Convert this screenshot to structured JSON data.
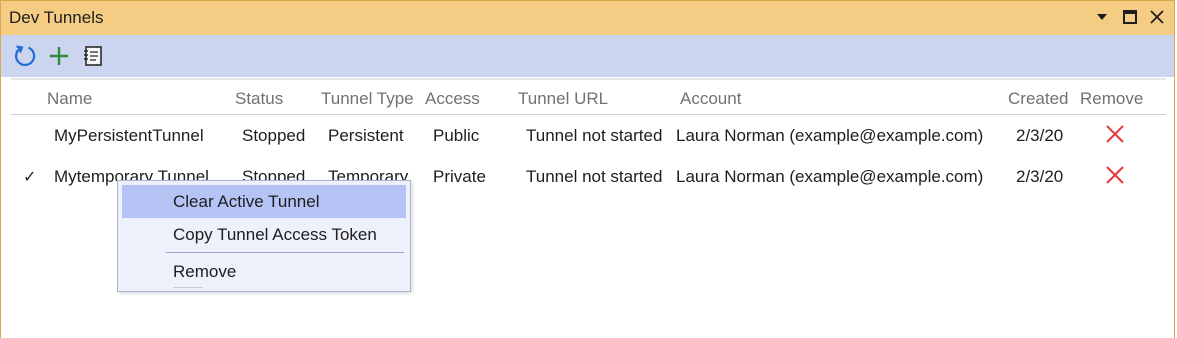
{
  "window": {
    "title": "Dev Tunnels",
    "buttons": {
      "dropdown": "chevron-down-icon",
      "maximize": "maximize-icon",
      "close": "close-icon"
    }
  },
  "toolbar": {
    "icons": [
      "refresh-icon",
      "add-icon",
      "notebook-icon"
    ]
  },
  "columns": [
    "Name",
    "Status",
    "Tunnel Type",
    "Access",
    "Tunnel URL",
    "Account",
    "Created",
    "Remove"
  ],
  "rows": [
    {
      "checked": "",
      "name": "MyPersistentTunnel",
      "status": "Stopped",
      "type": "Persistent",
      "access": "Public",
      "url": "Tunnel not started",
      "account": "Laura Norman (example@example.com)",
      "created": "2/3/20"
    },
    {
      "checked": "✓",
      "name": "Mytemporary Tunnel",
      "status": "Stopped",
      "type": "Temporary",
      "access": "Private",
      "url": "Tunnel not started",
      "account": "Laura Norman (example@example.com)",
      "created": "2/3/20"
    }
  ],
  "context_menu": {
    "items": [
      "Clear Active Tunnel",
      "Copy Tunnel Access Token",
      "Remove"
    ]
  },
  "colors": {
    "title_bar": "#f5cc84",
    "toolbar": "#ccd5f0",
    "remove_icon": "#e5383b",
    "menu_highlight": "#b5c3f5"
  }
}
